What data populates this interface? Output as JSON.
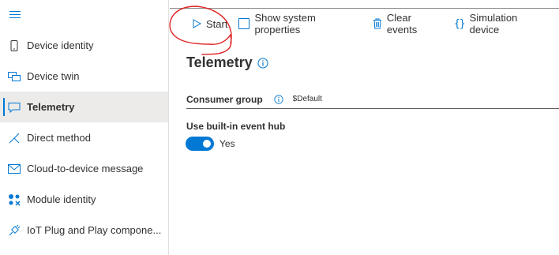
{
  "sidebar": {
    "items": [
      {
        "label": "Device identity",
        "icon": "phone-icon"
      },
      {
        "label": "Device twin",
        "icon": "device-twin-icon"
      },
      {
        "label": "Telemetry",
        "icon": "chat-icon",
        "active": true
      },
      {
        "label": "Direct method",
        "icon": "direct-method-icon"
      },
      {
        "label": "Cloud-to-device message",
        "icon": "mail-icon"
      },
      {
        "label": "Module identity",
        "icon": "module-icon"
      },
      {
        "label": "IoT Plug and Play compone...",
        "icon": "plug-icon"
      }
    ]
  },
  "toolbar": {
    "start_label": "Start",
    "show_system_properties_label": "Show system properties",
    "clear_events_label": "Clear events",
    "simulation_device_label": "Simulation device",
    "braces_glyph": "{}"
  },
  "main": {
    "title": "Telemetry",
    "consumer_group_label": "Consumer group",
    "consumer_group_value": "$Default",
    "event_hub_label": "Use built-in event hub",
    "event_hub_toggle_on": true,
    "event_hub_toggle_text": "Yes"
  },
  "colors": {
    "accent": "#0078d4",
    "annotation": "#e02020",
    "active_bg": "#edebe9"
  }
}
